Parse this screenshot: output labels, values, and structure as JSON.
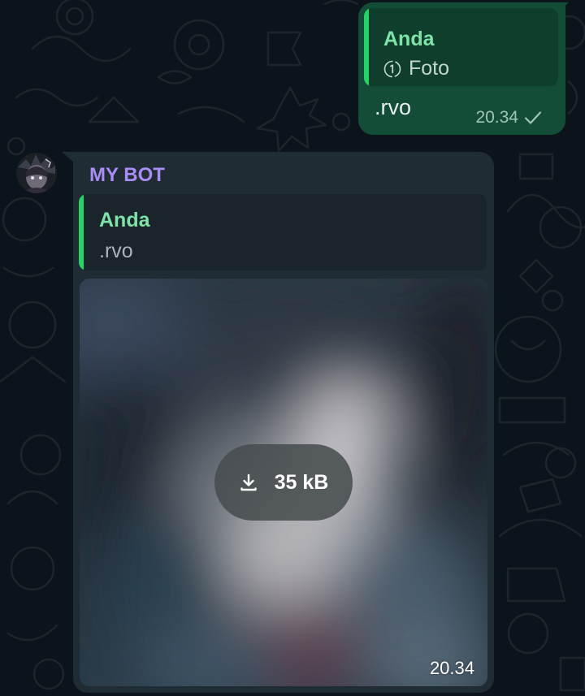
{
  "outgoing_message": {
    "quote_sender": "Anda",
    "quote_media_label": "Foto",
    "quote_media_icon": "view-once-icon",
    "text": ".rvo",
    "time": "20.34",
    "status_icon": "check-icon"
  },
  "incoming_message": {
    "sender_name": "MY BOT",
    "quote_sender": "Anda",
    "quote_text": ".rvo",
    "attachment_size": "35 kB",
    "attachment_icon": "download-icon",
    "time": "20.34"
  },
  "colors": {
    "chat_background": "#0b141a",
    "outgoing_bubble": "#144d37",
    "incoming_bubble": "#1f2c33",
    "quote_accent": "#25d366",
    "quote_name": "#7fe3a7",
    "sender_name": "#a98cf5"
  }
}
